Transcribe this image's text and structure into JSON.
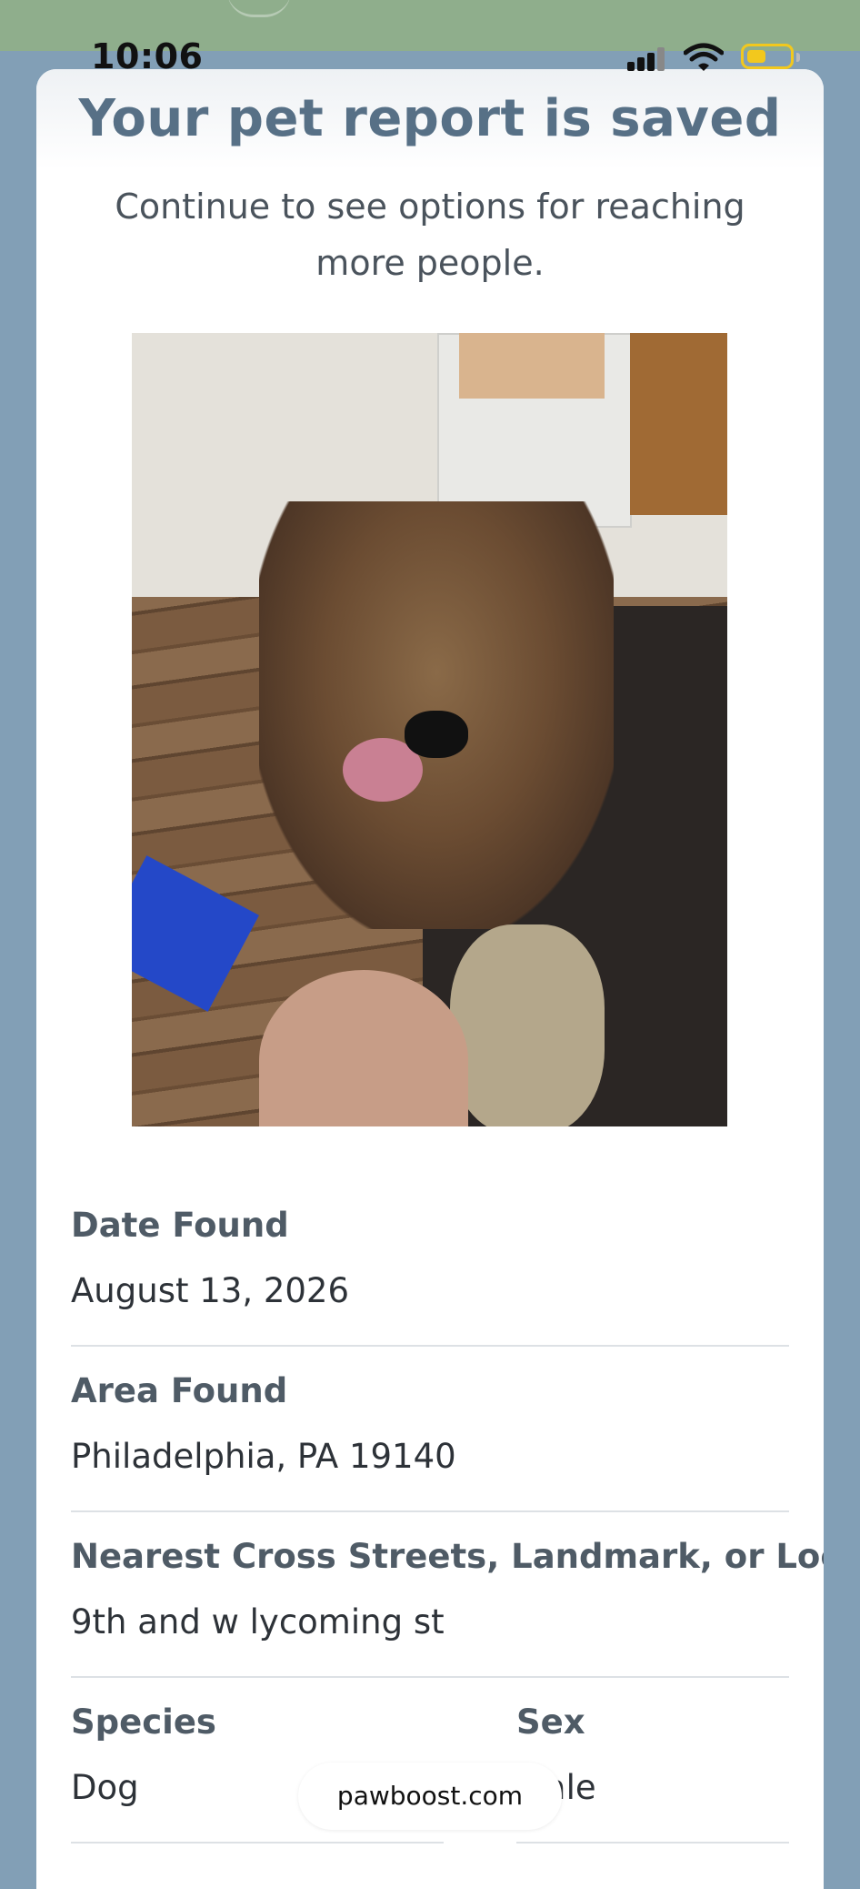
{
  "status_bar": {
    "time": "10:06",
    "icons": [
      "cellular-signal-icon",
      "wifi-icon",
      "battery-icon"
    ],
    "battery_color": "#f2c81d"
  },
  "report": {
    "title": "Your pet report is saved",
    "subtitle": "Continue to see options for reaching more people."
  },
  "fields": {
    "date_found": {
      "label": "Date Found",
      "value": "August 13, 2026"
    },
    "area_found": {
      "label": "Area Found",
      "value": "Philadelphia, PA 19140"
    },
    "cross_streets": {
      "label": "Nearest Cross Streets, Landmark, or Location",
      "value": "9th and w lycoming st"
    },
    "species": {
      "label": "Species",
      "value": "Dog"
    },
    "sex": {
      "label": "Sex",
      "value": "Male"
    }
  },
  "browser": {
    "url": "pawboost.com"
  },
  "colors": {
    "background": "#829fb6",
    "top_band": "#8fae8c",
    "title": "#577086",
    "label": "#4f5b66"
  }
}
